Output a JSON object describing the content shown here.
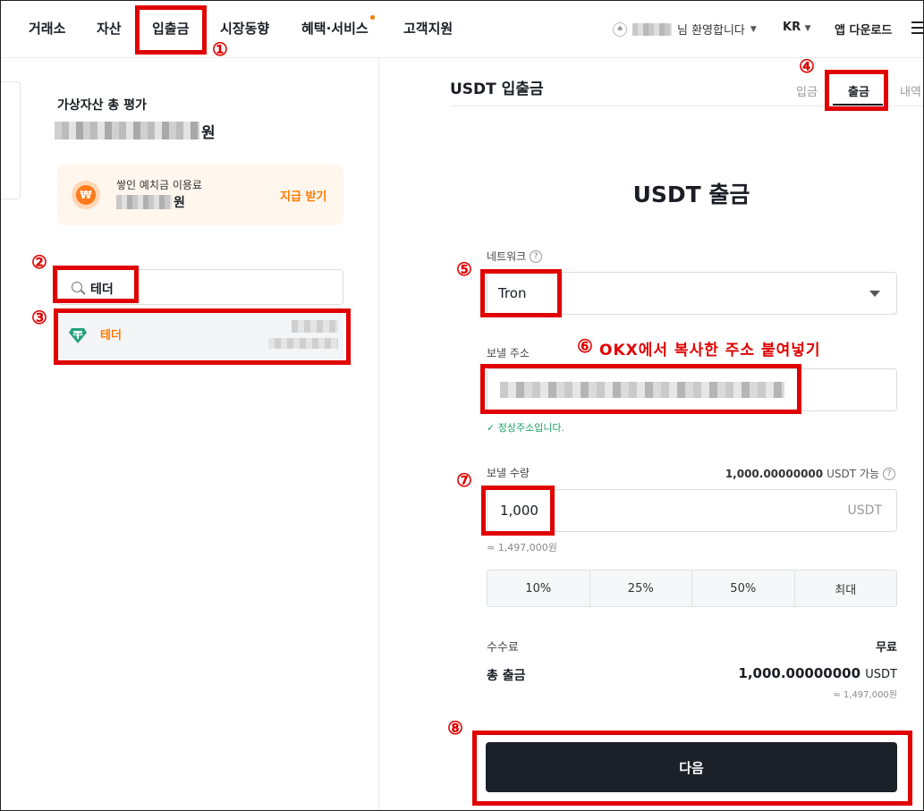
{
  "header": {
    "nav": [
      "거래소",
      "자산",
      "입출금",
      "시장동향",
      "혜택·서비스",
      "고객지원"
    ],
    "welcome_suffix": "님 환영합니다",
    "language": "KR",
    "app_download": "앱 다운로드"
  },
  "left": {
    "total_label": "가상자산 총 평가",
    "won": "원",
    "fee_card": {
      "label": "쌓인 예치금 이용료",
      "won": "원",
      "claim": "지급 받기",
      "icon_glyph": "₩"
    },
    "search": {
      "value": "테더"
    },
    "coin": {
      "name": "테더",
      "icon_glyph": "T"
    }
  },
  "right": {
    "title": "USDT 입출금",
    "tabs": [
      "입금",
      "출금",
      "내역"
    ],
    "active_tab": "출금",
    "form_title": "USDT 출금",
    "network": {
      "label": "네트워크",
      "value": "Tron"
    },
    "address": {
      "label": "보낼 주소",
      "valid_msg": "✓ 정상주소입니다."
    },
    "amount": {
      "label": "보낼 수량",
      "available": "1,000.00000000",
      "available_suffix": "USDT 가능",
      "value": "1,000",
      "unit": "USDT",
      "krw": "≈ 1,497,000원"
    },
    "percent_buttons": [
      "10%",
      "25%",
      "50%",
      "최대"
    ],
    "fee": {
      "label": "수수료",
      "value": "무료"
    },
    "total": {
      "label": "총 출금",
      "value": "1,000.00000000",
      "unit": "USDT",
      "krw": "≈ 1,497,000원"
    },
    "next_button": "다음"
  },
  "annotations": {
    "numbers": [
      "①",
      "②",
      "③",
      "④",
      "⑤",
      "⑥",
      "⑦",
      "⑧"
    ],
    "note": "OKX에서 복사한 주소 붙여넣기"
  },
  "colors": {
    "accent_orange": "#ff7a00",
    "valid_green": "#1aa163",
    "tether_green": "#26a17b",
    "button_dark": "#1c2028",
    "annotation_red": "#e00000"
  }
}
